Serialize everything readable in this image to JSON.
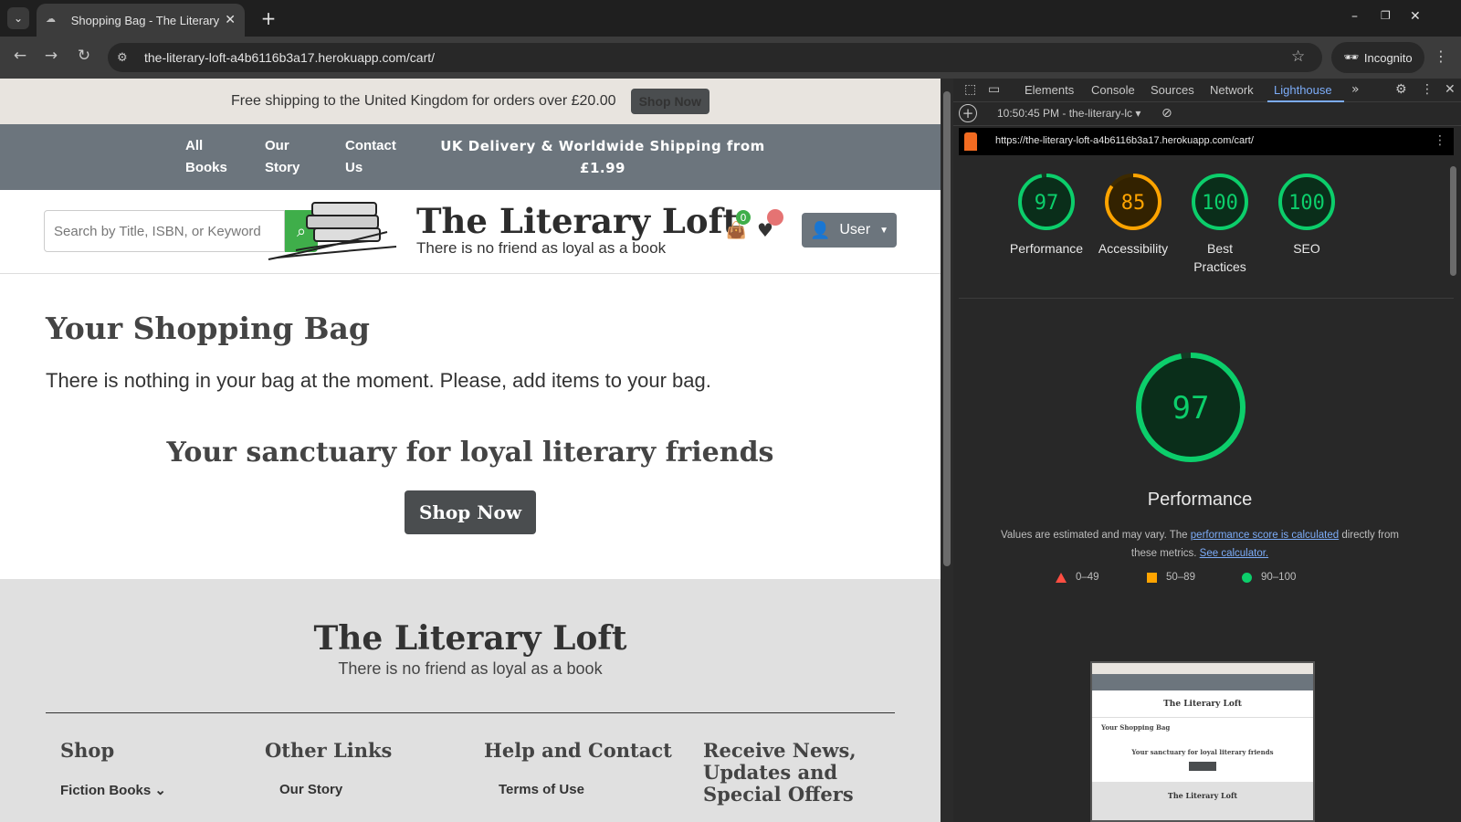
{
  "browser": {
    "tab_title": "Shopping Bag - The Literary Loft",
    "url": "the-literary-loft-a4b6116b3a17.herokuapp.com/cart/",
    "incognito_label": "Incognito"
  },
  "site": {
    "banner_text": "Free shipping to the United Kingdom for orders over £20.00",
    "banner_button": "Shop Now",
    "nav": {
      "all": [
        "All",
        "Books"
      ],
      "story": [
        "Our",
        "Story"
      ],
      "contact": [
        "Contact",
        "Us"
      ],
      "promo": "UK Delivery & Worldwide Shipping from £1.99"
    },
    "search_placeholder": "Search by Title, ISBN, or Keyword",
    "brand": "The Literary Loft",
    "tagline": "There is no friend as loyal as a book",
    "bag_count": "0",
    "user_label": "User",
    "heading": "Your Shopping Bag",
    "empty_message": "There is nothing in your bag at the moment. Please, add items to your bag.",
    "sanctuary_heading": "Your sanctuary for loyal literary friends",
    "shop_now": "Shop Now",
    "footer": {
      "brand": "The Literary Loft",
      "tagline": "There is no friend as loyal as a book",
      "col1_head": "Shop",
      "col1_link": "Fiction Books",
      "col2_head": "Other Links",
      "col2_link": "Our Story",
      "col3_head": "Help and Contact",
      "col3_link": "Terms of Use",
      "col4_head": [
        "Receive News,",
        "Updates and",
        "Special Offers"
      ]
    }
  },
  "devtools": {
    "tabs": [
      "Elements",
      "Console",
      "Sources",
      "Network",
      "Lighthouse"
    ],
    "active_tab": "Lighthouse",
    "report_time": "10:50:45 PM - the-literary-lc",
    "report_url": "https://the-literary-loft-a4b6116b3a17.herokuapp.com/cart/",
    "scores": [
      {
        "label": "Performance",
        "value": 97,
        "color": "#0cce6b"
      },
      {
        "label": "Accessibility",
        "value": 85,
        "color": "#ffa400"
      },
      {
        "label": "Best Practices",
        "value": 100,
        "color": "#0cce6b"
      },
      {
        "label": "SEO",
        "value": 100,
        "color": "#0cce6b"
      }
    ],
    "perf_title": "Performance",
    "perf_score": "97",
    "note_before": "Values are estimated and may vary. The ",
    "note_link1": "performance score is calculated",
    "note_middle": " directly from these metrics. ",
    "note_link2": "See calculator.",
    "legend": [
      "0–49",
      "50–89",
      "90–100"
    ],
    "legend_colors": {
      "fail": "#ff4e42",
      "average": "#ffa400",
      "pass": "#0cce6b"
    }
  }
}
